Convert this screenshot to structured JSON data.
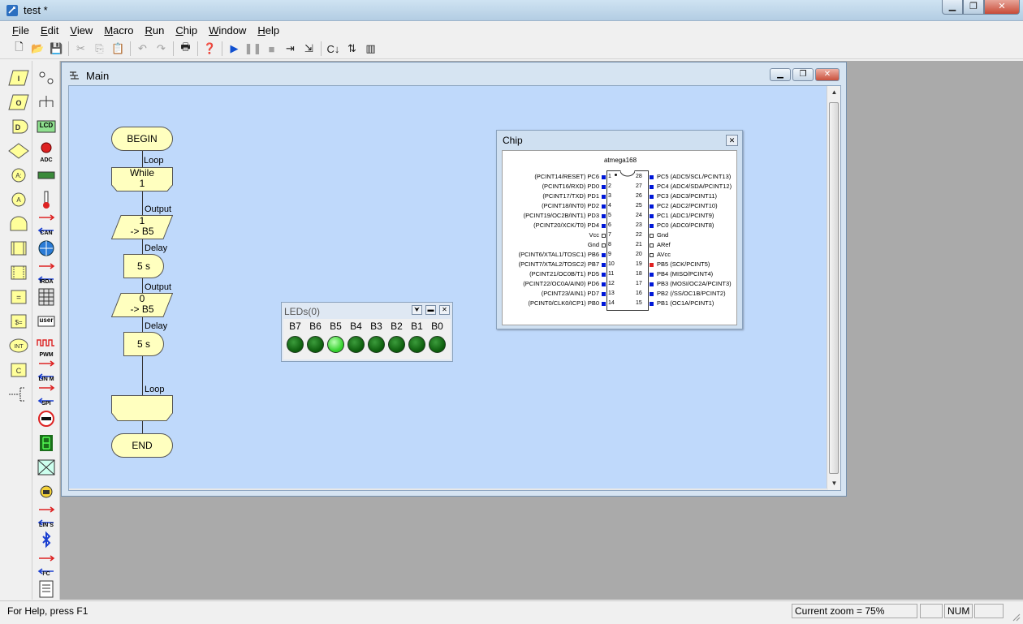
{
  "window": {
    "title": "test *"
  },
  "menu": [
    "File",
    "Edit",
    "View",
    "Macro",
    "Run",
    "Chip",
    "Window",
    "Help"
  ],
  "menu_accels": [
    "F",
    "E",
    "V",
    "M",
    "R",
    "C",
    "W",
    "H"
  ],
  "toolbar": [
    {
      "name": "new-icon",
      "glyph": "🗋",
      "enabled": true
    },
    {
      "name": "open-icon",
      "glyph": "📂",
      "enabled": true
    },
    {
      "name": "save-icon",
      "glyph": "💾",
      "enabled": true
    },
    {
      "sep": true
    },
    {
      "name": "cut-icon",
      "glyph": "✂",
      "enabled": false
    },
    {
      "name": "copy-icon",
      "glyph": "⎘",
      "enabled": false
    },
    {
      "name": "paste-icon",
      "glyph": "📋",
      "enabled": false
    },
    {
      "sep": true
    },
    {
      "name": "undo-icon",
      "glyph": "↶",
      "enabled": false
    },
    {
      "name": "redo-icon",
      "glyph": "↷",
      "enabled": false
    },
    {
      "sep": true
    },
    {
      "name": "print-icon",
      "glyph": "🖶",
      "enabled": true
    },
    {
      "sep": true
    },
    {
      "name": "help-icon",
      "glyph": "❓",
      "enabled": true
    },
    {
      "sep": true
    },
    {
      "name": "run-icon",
      "glyph": "▶",
      "enabled": true
    },
    {
      "name": "pause-icon",
      "glyph": "❚❚",
      "enabled": false
    },
    {
      "name": "stop-icon",
      "glyph": "■",
      "enabled": false
    },
    {
      "name": "step-over-icon",
      "glyph": "⇥",
      "enabled": true
    },
    {
      "name": "step-into-icon",
      "glyph": "⇲",
      "enabled": true
    },
    {
      "sep": true
    },
    {
      "name": "compile-icon",
      "glyph": "C↓",
      "enabled": true
    },
    {
      "name": "compile-chip-icon",
      "glyph": "⇅",
      "enabled": true
    },
    {
      "name": "chip-program-icon",
      "glyph": "▥",
      "enabled": true
    }
  ],
  "palette_left": [
    "input-icon",
    "output-icon",
    "delay-icon",
    "decision-icon",
    "connection-point-icon",
    "goto-icon",
    "macro-icon",
    "loop-icon",
    "component-macro-icon",
    "calculation-icon",
    "string-manipulation-icon",
    "interrupt-icon",
    "c-code-icon",
    "comment-icon"
  ],
  "palette_right": [
    {
      "name": "led-component-icon",
      "text": ""
    },
    {
      "name": "switch-component-icon",
      "text": ""
    },
    {
      "name": "lcd-component-icon",
      "text": "LCD"
    },
    {
      "name": "adc-component-icon",
      "text": "ADC"
    },
    {
      "name": "keypad-component-icon",
      "text": ""
    },
    {
      "name": "thermometer-component-icon",
      "text": ""
    },
    {
      "name": "can-component-icon",
      "text": "CAN"
    },
    {
      "name": "web-component-icon",
      "text": ""
    },
    {
      "name": "irda-component-icon",
      "text": "IRDA"
    },
    {
      "name": "keypad-grid-component-icon",
      "text": ""
    },
    {
      "name": "user-component-icon",
      "text": "user"
    },
    {
      "name": "pwm-component-icon",
      "text": "PWM"
    },
    {
      "name": "lin-master-component-icon",
      "text": "LIN M"
    },
    {
      "name": "spi-component-icon",
      "text": "SPI"
    },
    {
      "name": "stop-component-icon",
      "text": ""
    },
    {
      "name": "seven-segment-component-icon",
      "text": ""
    },
    {
      "name": "graphic-lcd-component-icon",
      "text": ""
    },
    {
      "name": "security-component-icon",
      "text": ""
    },
    {
      "name": "lin-slave-component-icon",
      "text": "LIN S"
    },
    {
      "name": "bluetooth-component-icon",
      "text": ""
    },
    {
      "name": "i2c-component-icon",
      "text": "I²C"
    },
    {
      "name": "file-component-icon",
      "text": ""
    }
  ],
  "main_window": {
    "title": "Main",
    "flowchart": {
      "begin": "BEGIN",
      "end": "END",
      "while_line1": "While",
      "while_line2": "1",
      "loop_label_top": "Loop",
      "loop_label_bottom": "Loop",
      "output1_label": "Output",
      "output1_line1": "1",
      "output1_line2": "-> B5",
      "delay1_label": "Delay",
      "delay1_text": "5 s",
      "output2_label": "Output",
      "output2_line1": "0",
      "output2_line2": "-> B5",
      "delay2_label": "Delay",
      "delay2_text": "5 s"
    }
  },
  "chip_window": {
    "title": "Chip",
    "chip_name": "atmega168",
    "left_pins": [
      {
        "num": "1",
        "label": "(PCINT14/RESET) PC6",
        "state": "blue"
      },
      {
        "num": "2",
        "label": "(PCINT16/RXD) PD0",
        "state": "blue"
      },
      {
        "num": "3",
        "label": "(PCINT17/TXD) PD1",
        "state": "blue"
      },
      {
        "num": "4",
        "label": "(PCINT18/INT0) PD2",
        "state": "blue"
      },
      {
        "num": "5",
        "label": "(PCINT19/OC2B/INT1) PD3",
        "state": "blue"
      },
      {
        "num": "6",
        "label": "(PCINT20/XCK/T0) PD4",
        "state": "blue"
      },
      {
        "num": "7",
        "label": "Vcc",
        "state": "white"
      },
      {
        "num": "8",
        "label": "Gnd",
        "state": "white"
      },
      {
        "num": "9",
        "label": "(PCINT6/XTAL1/TOSC1) PB6",
        "state": "blue"
      },
      {
        "num": "10",
        "label": "(PCINT7/XTAL2/TOSC2) PB7",
        "state": "blue"
      },
      {
        "num": "11",
        "label": "(PCINT21/OC0B/T1) PD5",
        "state": "blue"
      },
      {
        "num": "12",
        "label": "(PCINT22/OC0A/AIN0) PD6",
        "state": "blue"
      },
      {
        "num": "13",
        "label": "(PCINT23/AIN1) PD7",
        "state": "blue"
      },
      {
        "num": "14",
        "label": "(PCINT0/CLK0/ICP1) PB0",
        "state": "blue"
      }
    ],
    "right_pins": [
      {
        "num": "28",
        "label": "PC5 (ADC5/SCL/PCINT13)",
        "state": "blue"
      },
      {
        "num": "27",
        "label": "PC4 (ADC4/SDA/PCINT12)",
        "state": "blue"
      },
      {
        "num": "26",
        "label": "PC3 (ADC3/PCINT11)",
        "state": "blue"
      },
      {
        "num": "25",
        "label": "PC2 (ADC2/PCINT10)",
        "state": "blue"
      },
      {
        "num": "24",
        "label": "PC1 (ADC1/PCINT9)",
        "state": "blue"
      },
      {
        "num": "23",
        "label": "PC0 (ADC0/PCINT8)",
        "state": "blue"
      },
      {
        "num": "22",
        "label": "Gnd",
        "state": "white"
      },
      {
        "num": "21",
        "label": "ARef",
        "state": "white"
      },
      {
        "num": "20",
        "label": "AVcc",
        "state": "white"
      },
      {
        "num": "19",
        "label": "PB5 (SCK/PCINT5)",
        "state": "red"
      },
      {
        "num": "18",
        "label": "PB4 (MISO/PCINT4)",
        "state": "blue"
      },
      {
        "num": "17",
        "label": "PB3 (MOSI/OC2A/PCINT3)",
        "state": "blue"
      },
      {
        "num": "16",
        "label": "PB2 (/SS/OC1B/PCINT2)",
        "state": "blue"
      },
      {
        "num": "15",
        "label": "PB1 (OC1A/PCINT1)",
        "state": "blue"
      }
    ]
  },
  "leds_window": {
    "title": "LEDs(0)",
    "leds": [
      {
        "label": "B7",
        "on": false
      },
      {
        "label": "B6",
        "on": false
      },
      {
        "label": "B5",
        "on": true
      },
      {
        "label": "B4",
        "on": false
      },
      {
        "label": "B3",
        "on": false
      },
      {
        "label": "B2",
        "on": false
      },
      {
        "label": "B1",
        "on": false
      },
      {
        "label": "B0",
        "on": false
      }
    ]
  },
  "status": {
    "help": "For Help, press F1",
    "zoom": "Current zoom = 75%",
    "num": "NUM"
  }
}
